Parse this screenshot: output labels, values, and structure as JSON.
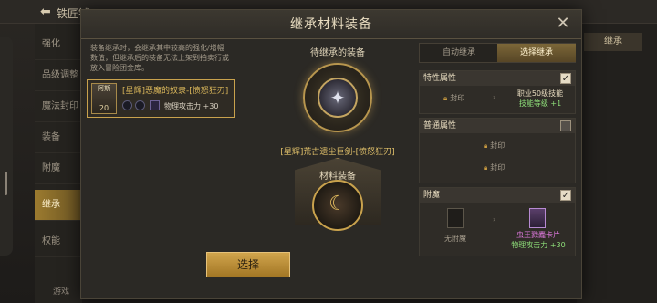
{
  "background": {
    "title": "铁匠铺",
    "side_items": [
      "强化",
      "品级调整",
      "魔法封印",
      "装备",
      "附魔",
      "继承",
      "权能"
    ],
    "right_tab": "继承",
    "bottom_text": "游戏"
  },
  "modal": {
    "title": "继承材料装备",
    "description": "装备继承时，会继承其中较高的强化/增幅数值，但继承后的装备无法上架到拍卖行或放入冒险团金库。",
    "item": {
      "icon_label": "阿斯",
      "level": "20",
      "name": "[星辉]恶魔的奴隶-[愤怒狂刃]",
      "stat": "物理攻击力 +30"
    },
    "middle": {
      "target_label": "待继承的装备",
      "weapon_name": "[星辉]荒古遗尘巨剑-[愤怒狂刃]",
      "material_label": "材料装备"
    },
    "tabs": {
      "auto": "自动继承",
      "select": "选择继承"
    },
    "special": {
      "title": "特性属性",
      "checked": true,
      "seal": "封印",
      "skill_line1": "职业50级技能",
      "skill_line2": "技能等级 +1"
    },
    "normal": {
      "title": "普通属性",
      "checked": false,
      "seal1": "封印",
      "seal2": "封印"
    },
    "enchant": {
      "title": "附魔",
      "checked": true,
      "none": "无附魔",
      "card_name": "虫王戮蠹卡片",
      "card_stat": "物理攻击力 +30"
    },
    "select_button": "选择"
  }
}
